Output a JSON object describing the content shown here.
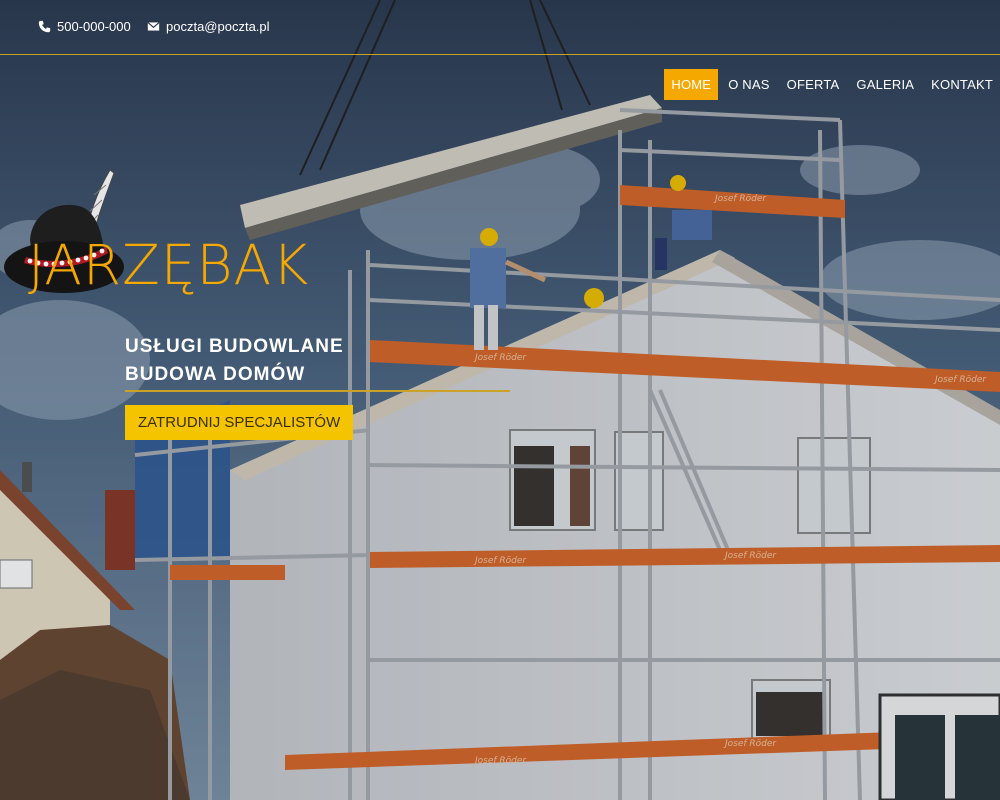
{
  "topbar": {
    "phone": "500-000-000",
    "email": "poczta@poczta.pl",
    "phone_icon": "phone-icon",
    "email_icon": "envelope-icon"
  },
  "nav": {
    "items": [
      {
        "label": "HOME",
        "active": true
      },
      {
        "label": "O NAS",
        "active": false
      },
      {
        "label": "OFERTA",
        "active": false
      },
      {
        "label": "GALERIA",
        "active": false
      },
      {
        "label": "KONTAKT",
        "active": false
      }
    ]
  },
  "hero": {
    "brand": "JARZĘBAK",
    "tagline_line1": "USŁUGI BUDOWLANE",
    "tagline_line2": "BUDOWA DOMÓW",
    "cta_label": "ZATRUDNIJ SPECJALISTÓW",
    "logo_icon": "feathered-hat-icon"
  },
  "scaffold_signs": [
    "Josef Röder",
    "Josef Röder",
    "Josef Röder",
    "Josef Röder",
    "Josef Röder",
    "Josef Röder",
    "Josef Röder"
  ],
  "colors": {
    "accent": "#f5a800",
    "cta": "#f5c400",
    "scaffold_orange": "#d9682a",
    "topbar_line": "#c9a227"
  }
}
